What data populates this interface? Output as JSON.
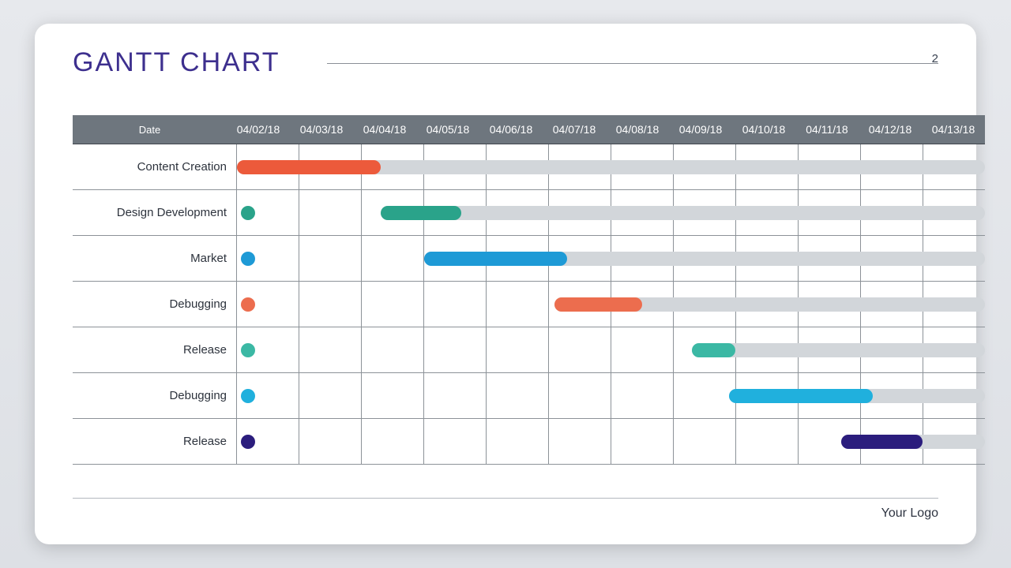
{
  "title": "GANTT CHART",
  "page_number": "2",
  "footer": "Your Logo",
  "header_label": "Date",
  "dates": [
    "04/02/18",
    "04/03/18",
    "04/04/18",
    "04/05/18",
    "04/06/18",
    "04/07/18",
    "04/08/18",
    "04/09/18",
    "04/10/18",
    "04/11/18",
    "04/12/18",
    "04/13/18"
  ],
  "tasks": [
    {
      "name": "Content Creation",
      "color": "#ec5a3b",
      "start": 0,
      "dur": 2.3,
      "dot": false
    },
    {
      "name": "Design Development",
      "color": "#2aa38a",
      "start": 2.3,
      "dur": 1.3,
      "dot": true
    },
    {
      "name": "Market",
      "color": "#1e9ad6",
      "start": 3.0,
      "dur": 2.3,
      "dot": true
    },
    {
      "name": "Debugging",
      "color": "#ec6d4e",
      "start": 5.1,
      "dur": 1.4,
      "dot": true
    },
    {
      "name": "Release",
      "color": "#3bb8a4",
      "start": 7.3,
      "dur": 0.7,
      "dot": true
    },
    {
      "name": "Debugging",
      "color": "#20b0dd",
      "start": 7.9,
      "dur": 2.3,
      "dot": true
    },
    {
      "name": "Release",
      "color": "#2b1d7d",
      "start": 9.7,
      "dur": 1.3,
      "dot": true
    }
  ],
  "chart_data": {
    "type": "bar",
    "title": "GANTT CHART",
    "xlabel": "Date",
    "ylabel": "",
    "categories": [
      "04/02/18",
      "04/03/18",
      "04/04/18",
      "04/05/18",
      "04/06/18",
      "04/07/18",
      "04/08/18",
      "04/09/18",
      "04/10/18",
      "04/11/18",
      "04/12/18",
      "04/13/18"
    ],
    "series": [
      {
        "name": "Content Creation",
        "start": "04/02/18",
        "end": "04/04/18",
        "color": "#ec5a3b"
      },
      {
        "name": "Design Development",
        "start": "04/04/18",
        "end": "04/05/18",
        "color": "#2aa38a"
      },
      {
        "name": "Market",
        "start": "04/05/18",
        "end": "04/07/18",
        "color": "#1e9ad6"
      },
      {
        "name": "Debugging",
        "start": "04/07/18",
        "end": "04/08/18",
        "color": "#ec6d4e"
      },
      {
        "name": "Release",
        "start": "04/09/18",
        "end": "04/10/18",
        "color": "#3bb8a4"
      },
      {
        "name": "Debugging",
        "start": "04/10/18",
        "end": "04/12/18",
        "color": "#20b0dd"
      },
      {
        "name": "Release",
        "start": "04/11/18",
        "end": "04/13/18",
        "color": "#2b1d7d"
      }
    ],
    "ylim": [
      0,
      7
    ],
    "xlim": [
      "04/02/18",
      "04/13/18"
    ]
  }
}
